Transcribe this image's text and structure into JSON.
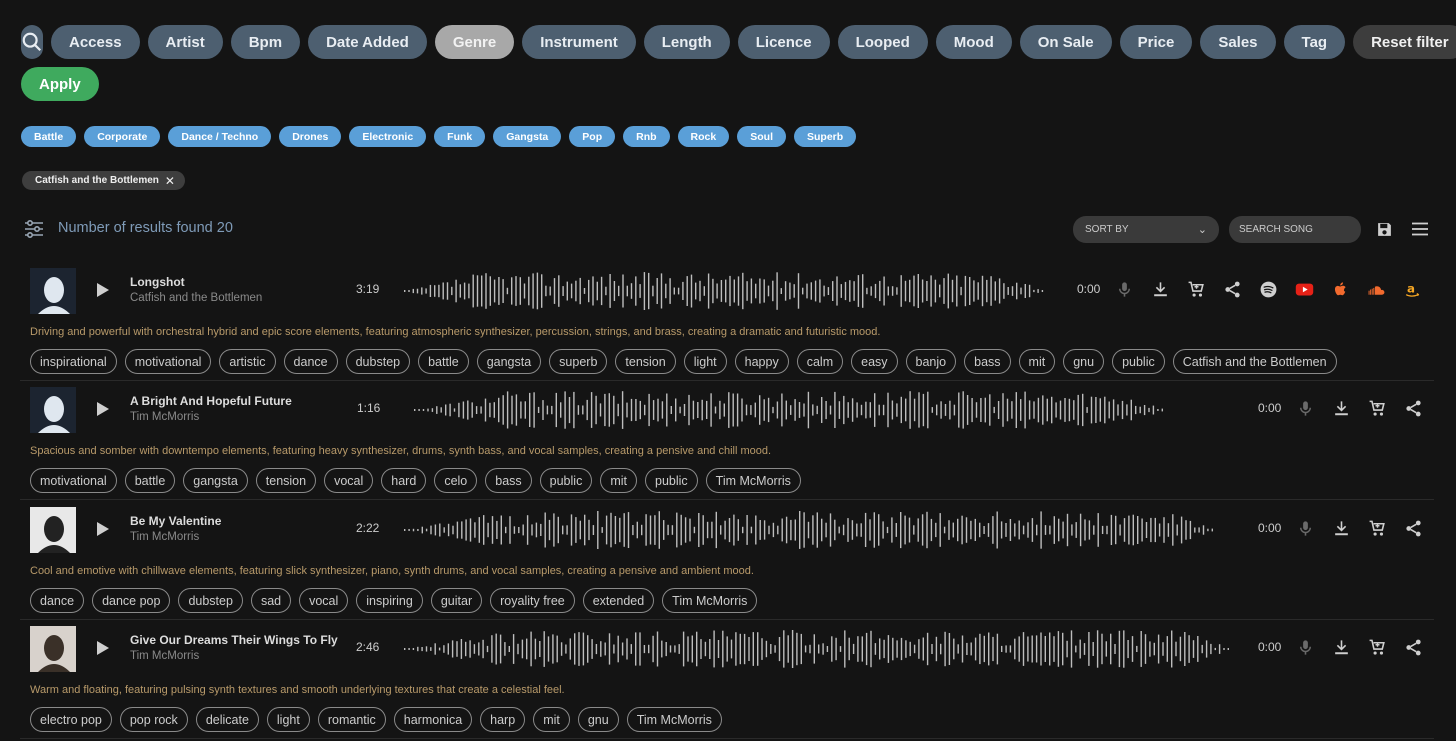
{
  "filters": {
    "search_icon": "search-icon",
    "items": [
      "Access",
      "Artist",
      "Bpm",
      "Date Added",
      "Genre",
      "Instrument",
      "Length",
      "Licence",
      "Looped",
      "Mood",
      "On Sale",
      "Price",
      "Sales",
      "Tag"
    ],
    "active": "Genre",
    "reset_label": "Reset filter",
    "apply_label": "Apply"
  },
  "genres": [
    "Battle",
    "Corporate",
    "Dance / Techno",
    "Drones",
    "Electronic",
    "Funk",
    "Gangsta",
    "Pop",
    "Rnb",
    "Rock",
    "Soul",
    "Superb"
  ],
  "active_filter": "Catfish and the Bottlemen",
  "results": {
    "text": "Number of results found 20",
    "sort_label": "SORT BY",
    "search_placeholder": "SEARCH SONG"
  },
  "colors": {
    "pill": "#4d5f70",
    "genre_chip": "#5a9fd8",
    "apply": "#3faa5e",
    "description": "#b89a6a",
    "results_text": "#7f9bb8"
  },
  "tracks": [
    {
      "title": "Longshot",
      "artist": "Catfish and the Bottlemen",
      "duration": "3:19",
      "time": "0:00",
      "description": "Driving and powerful with orchestral hybrid and epic score elements, featuring atmospheric synthesizer, percussion, strings, and brass, creating a dramatic and futuristic mood.",
      "tags": [
        "inspirational",
        "motivational",
        "artistic",
        "dance",
        "dubstep",
        "battle",
        "gangsta",
        "superb",
        "tension",
        "light",
        "happy",
        "calm",
        "easy",
        "banjo",
        "bass",
        "mit",
        "gnu",
        "public",
        "Catfish and the Bottlemen"
      ],
      "icons": [
        "mic-icon",
        "download-icon",
        "cart-icon",
        "share-icon",
        "spotify-icon",
        "youtube-icon",
        "apple-icon",
        "soundcloud-icon",
        "amazon-icon"
      ]
    },
    {
      "title": "A Bright And Hopeful Future",
      "artist": "Tim McMorris",
      "duration": "1:16",
      "time": "0:00",
      "description": "Spacious and somber with downtempo elements, featuring heavy synthesizer, drums, synth bass, and vocal samples, creating a pensive and chill mood.",
      "tags": [
        "motivational",
        "battle",
        "gangsta",
        "tension",
        "vocal",
        "hard",
        "celo",
        "bass",
        "public",
        "mit",
        "public",
        "Tim McMorris"
      ],
      "icons": [
        "mic-icon",
        "download-icon",
        "cart-icon",
        "share-icon"
      ]
    },
    {
      "title": "Be My Valentine",
      "artist": "Tim McMorris",
      "duration": "2:22",
      "time": "0:00",
      "description": "Cool and emotive with chillwave elements, featuring slick synthesizer, piano, synth drums, and vocal samples, creating a pensive and ambient mood.",
      "tags": [
        "dance",
        "dance pop",
        "dubstep",
        "sad",
        "vocal",
        "inspiring",
        "guitar",
        "royality free",
        "extended",
        "Tim McMorris"
      ],
      "icons": [
        "mic-icon",
        "download-icon",
        "cart-icon",
        "share-icon"
      ]
    },
    {
      "title": "Give Our Dreams Their Wings To Fly",
      "artist": "Tim McMorris",
      "duration": "2:46",
      "time": "0:00",
      "description": "Warm and floating, featuring pulsing synth textures and smooth underlying textures that create a celestial feel.",
      "tags": [
        "electro pop",
        "pop rock",
        "delicate",
        "light",
        "romantic",
        "harmonica",
        "harp",
        "mit",
        "gnu",
        "Tim McMorris"
      ],
      "icons": [
        "mic-icon",
        "download-icon",
        "cart-icon",
        "share-icon"
      ]
    }
  ]
}
